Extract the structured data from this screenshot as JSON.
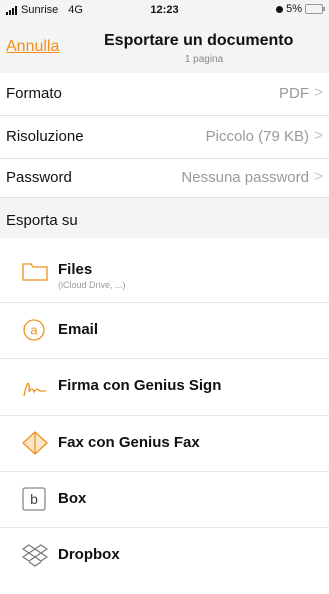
{
  "status": {
    "carrier": "Sunrise",
    "network": "4G",
    "time": "12:23",
    "battery": "5%"
  },
  "nav": {
    "cancel_label": "Annulla",
    "title": "Esportare un documento",
    "subtitle": "1 pagina"
  },
  "settings": [
    {
      "label": "Formato",
      "value": "PDF"
    },
    {
      "label": "Risoluzione",
      "value": "Piccolo (79 KB)"
    },
    {
      "label": "Password",
      "value": "Nessuna password"
    }
  ],
  "section_title": "Esporta su",
  "destinations": [
    {
      "label": "Files",
      "sublabel": "(iCloud Drive, ...)",
      "icon": "folder-icon"
    },
    {
      "label": "Email",
      "icon": "at-sign-icon"
    },
    {
      "label": "Firma con Genius Sign",
      "icon": "signature-icon"
    },
    {
      "label": "Fax con Genius Fax",
      "icon": "diamond-icon"
    },
    {
      "label": "Box",
      "icon": "box-icon"
    },
    {
      "label": "Dropbox",
      "icon": "dropbox-icon"
    }
  ],
  "colors": {
    "accent": "#f28f1c",
    "text": "#111111",
    "muted": "#9a9a9a",
    "bar": "#f4f4f4"
  }
}
